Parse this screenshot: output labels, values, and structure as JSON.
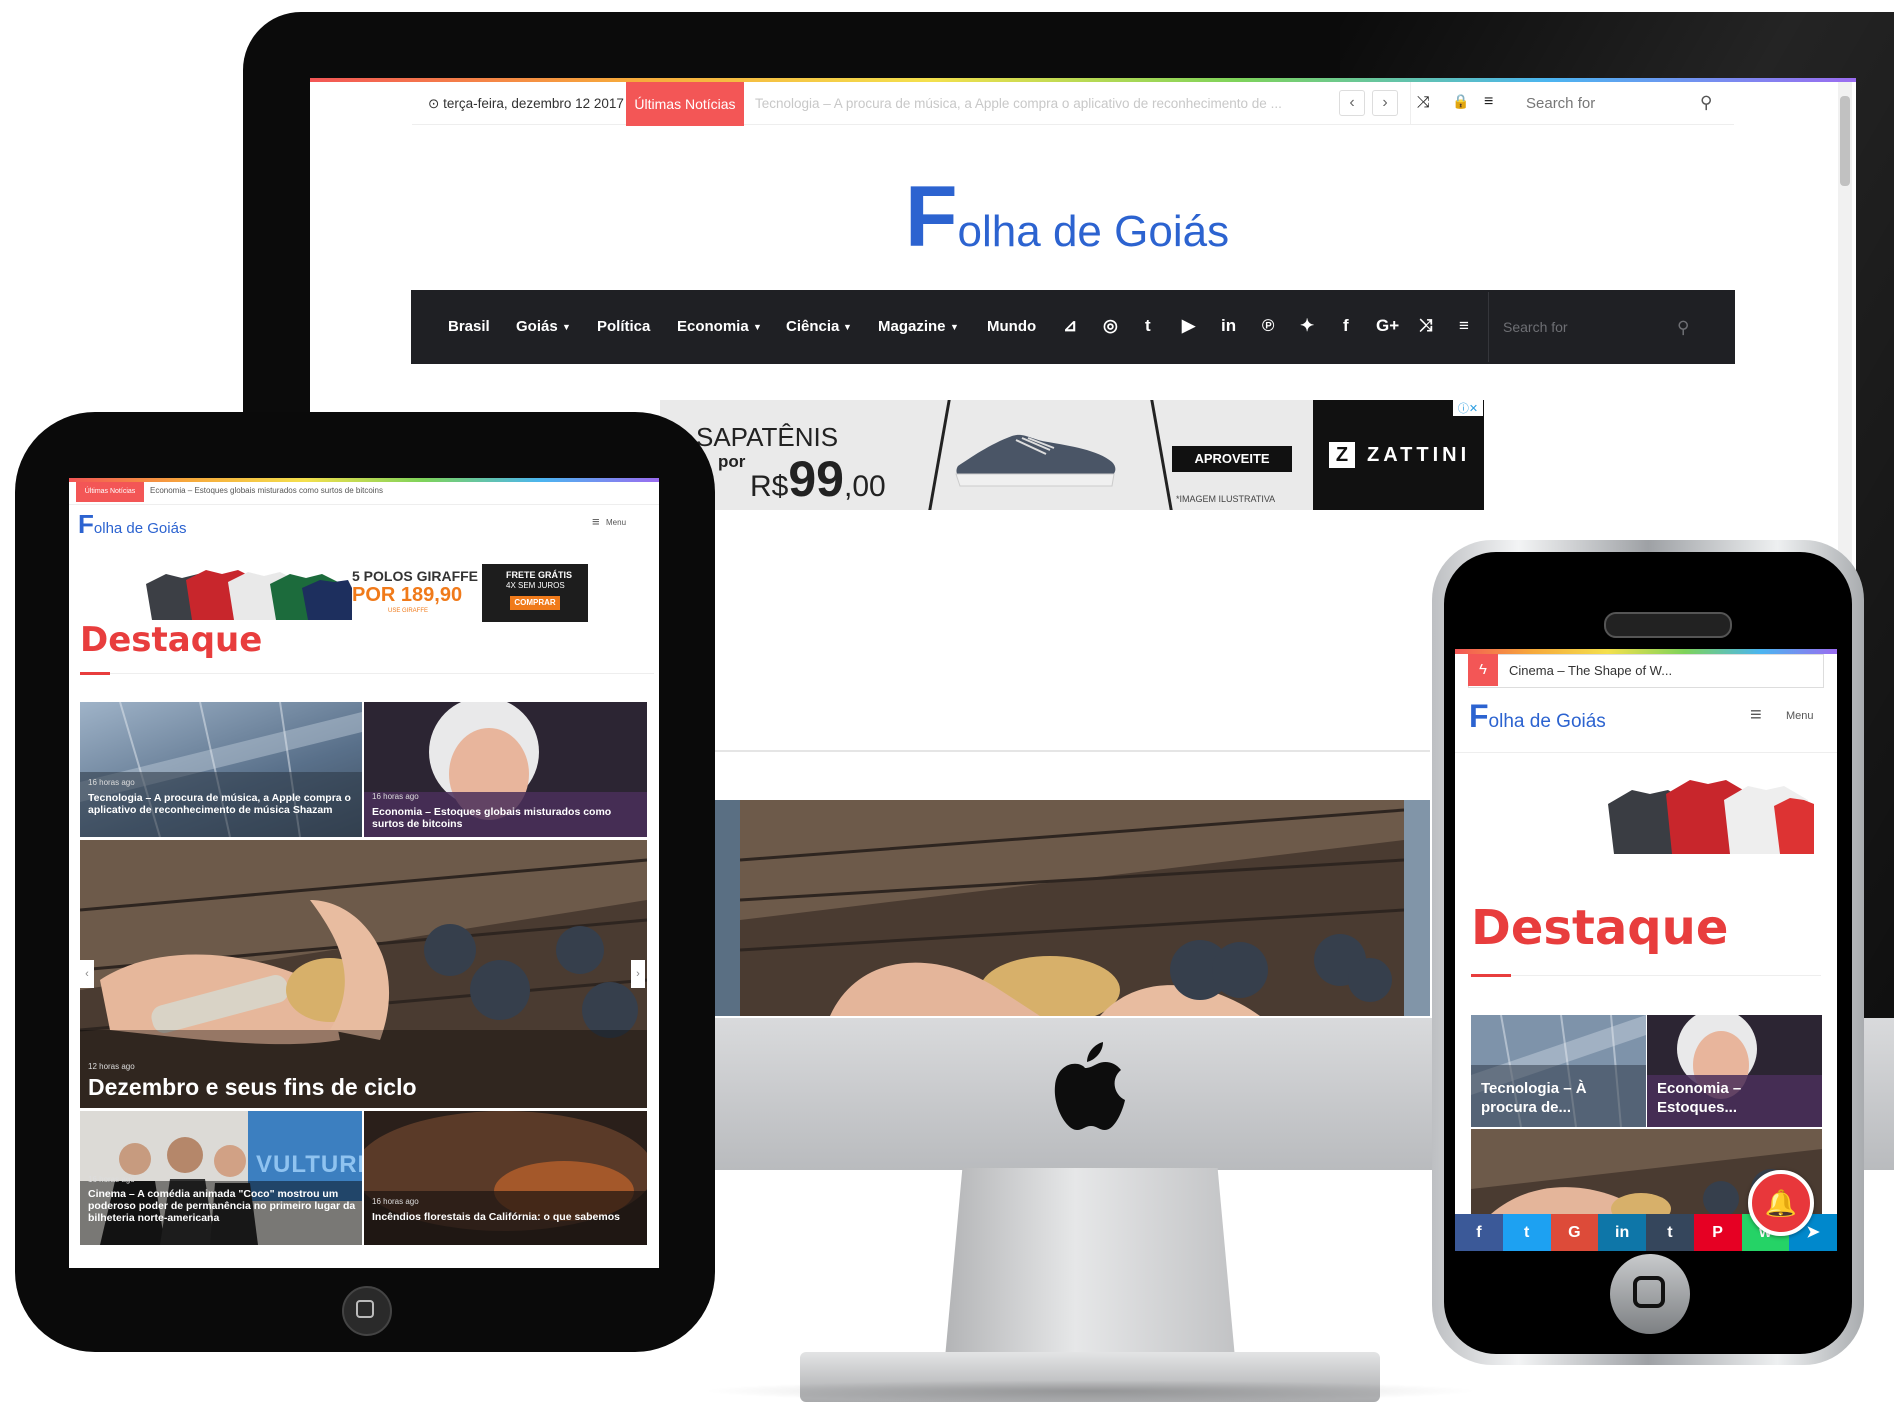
{
  "desktop": {
    "date": "terça-feira, dezembro 12 2017",
    "breaking_label": "Últimas Notícias",
    "ticker": "Tecnologia – A procura de música, a Apple compra o aplicativo de reconhecimento de ...",
    "search_placeholder": "Search for",
    "logo_initial": "F",
    "logo_rest": "olha de Goiás",
    "nav": [
      "Brasil",
      "Goiás",
      "Política",
      "Economia",
      "Ciência",
      "Magazine",
      "Mundo"
    ],
    "nav_dropdown": [
      false,
      true,
      false,
      true,
      true,
      true,
      false
    ],
    "nav_search_placeholder": "Search for",
    "ad": {
      "product": "SAPATÊNIS",
      "por": "por",
      "currency": "R$",
      "price_int": "99",
      "price_dec": ",00",
      "cta": "APROVEITE",
      "disclaimer": "*IMAGEM ILUSTRATIVA",
      "brand": "ZATTINI"
    }
  },
  "tablet": {
    "breaking_label": "Últimas Notícias",
    "ticker": "Economia – Estoques globais misturados como surtos de bitcoins",
    "logo_initial": "F",
    "logo_rest": "olha de Goiás",
    "menu_label": "Menu",
    "ad": {
      "line1": "5 POLOS GIRAFFE",
      "line2": "POR 189,90",
      "brand": "USE GIRAFFE",
      "frete": "FRETE GRÁTIS",
      "juros": "4X SEM JUROS",
      "cta": "COMPRAR"
    },
    "section_title": "Destaque",
    "cards": [
      {
        "time": "16 horas ago",
        "title": "Tecnologia – A procura de música, a Apple compra o aplicativo de reconhecimento de música Shazam"
      },
      {
        "time": "16 horas ago",
        "title": "Economia – Estoques globais misturados como surtos de bitcoins"
      },
      {
        "time": "12 horas ago",
        "title": "Dezembro e seus fins de ciclo"
      },
      {
        "time": "16 horas ago",
        "title": "Cinema – A comédia animada \"Coco\" mostrou um poderoso poder de permanência no primeiro lugar da bilheteria norte-americana"
      },
      {
        "time": "16 horas ago",
        "title": "Incêndios florestais da Califórnia: o que sabemos"
      }
    ],
    "poster_text": "VULTURE"
  },
  "phone": {
    "ticker": "Cinema – The Shape of W...",
    "logo_initial": "F",
    "logo_rest": "olha de Goiás",
    "menu_label": "Menu",
    "section_title": "Destaque",
    "cards": [
      {
        "title": "Tecnologia – À procura de..."
      },
      {
        "title": "Economia – Estoques..."
      }
    ],
    "share": [
      {
        "label": "f",
        "color": "#3b5998"
      },
      {
        "label": "t",
        "color": "#1da1f2"
      },
      {
        "label": "G",
        "color": "#dd4b39"
      },
      {
        "label": "in",
        "color": "#0e76a8"
      },
      {
        "label": "t",
        "color": "#35465c"
      },
      {
        "label": "P",
        "color": "#e60023"
      },
      {
        "label": "w",
        "color": "#25d366"
      },
      {
        "label": "➤",
        "color": "#0088cc"
      }
    ]
  },
  "colors": {
    "accent": "#f35656",
    "logo_blue": "#2c63d0",
    "nav_bg": "#1f2024",
    "destaque_red": "#e83d3d"
  }
}
